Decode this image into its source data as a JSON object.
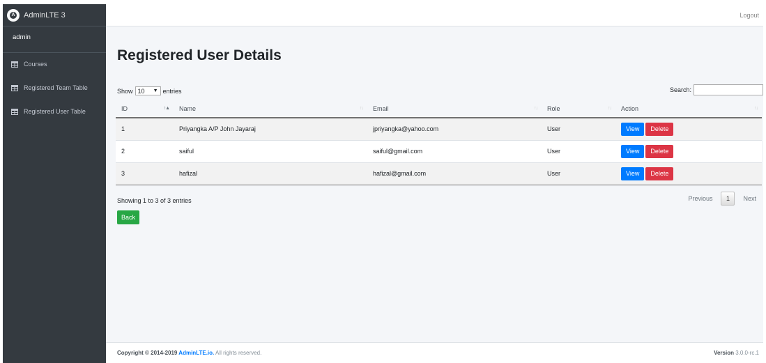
{
  "brand": {
    "name": "AdminLTE 3",
    "logo_icon": "adminlte-logo-icon"
  },
  "user": {
    "name": "admin"
  },
  "sidebar": {
    "items": [
      {
        "label": "Courses",
        "icon": "table-icon"
      },
      {
        "label": "Registered Team Table",
        "icon": "table-icon"
      },
      {
        "label": "Registered User Table",
        "icon": "table-icon"
      }
    ]
  },
  "navbar": {
    "logout": "Logout"
  },
  "page": {
    "title": "Registered User Details"
  },
  "datatable": {
    "length": {
      "prefix": "Show",
      "value": "10",
      "suffix": "entries"
    },
    "search": {
      "label": "Search:",
      "value": ""
    },
    "columns": [
      "ID",
      "Name",
      "Email",
      "Role",
      "Action"
    ],
    "rows": [
      {
        "id": "1",
        "name": "Priyangka A/P John Jayaraj",
        "email": "jpriyangka@yahoo.com",
        "role": "User"
      },
      {
        "id": "2",
        "name": "saiful",
        "email": "saiful@gmail.com",
        "role": "User"
      },
      {
        "id": "3",
        "name": "hafizal",
        "email": "hafizal@gmail.com",
        "role": "User"
      }
    ],
    "view_label": "View",
    "delete_label": "Delete",
    "info": "Showing 1 to 3 of 3 entries",
    "pagination": {
      "previous": "Previous",
      "current": "1",
      "next": "Next"
    }
  },
  "back_label": "Back",
  "footer": {
    "copyright_prefix": "Copyright © 2014-2019 ",
    "link": "AdminLTE.io.",
    "rights": " All rights reserved.",
    "version_label": "Version",
    "version_value": " 3.0.0-rc.1"
  },
  "colors": {
    "sidebar_bg": "#343a40",
    "primary": "#007bff",
    "danger": "#dc3545",
    "success": "#28a745"
  }
}
